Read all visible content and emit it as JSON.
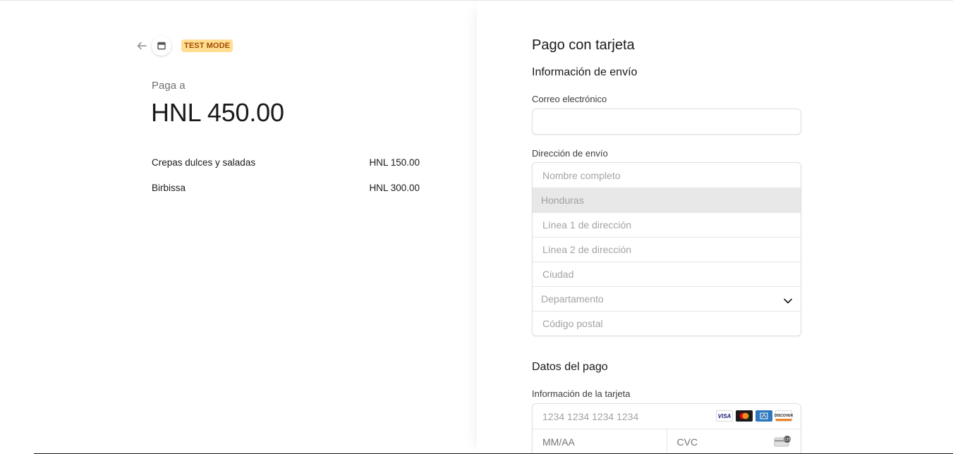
{
  "header": {
    "badge": "TEST MODE"
  },
  "summary": {
    "pay_to_label": "Paga a",
    "total": "HNL 450.00",
    "items": [
      {
        "name": "Crepas dulces y saladas",
        "price": "HNL 150.00"
      },
      {
        "name": "Birbissa",
        "price": "HNL 300.00"
      }
    ]
  },
  "form": {
    "title": "Pago con tarjeta",
    "shipping_section": "Información de envío",
    "email_label": "Correo electrónico",
    "email_value": "",
    "address_label": "Dirección de envío",
    "address": {
      "name_placeholder": "Nombre completo",
      "country": "Honduras",
      "line1_placeholder": "Línea 1 de dirección",
      "line2_placeholder": "Línea 2 de dirección",
      "city_placeholder": "Ciudad",
      "state_placeholder": "Departamento",
      "postal_placeholder": "Código postal"
    },
    "payment_section": "Datos del pago",
    "card_label": "Información de la tarjeta",
    "card": {
      "number_placeholder": "1234 1234 1234 1234",
      "expiry_placeholder": "MM/AA",
      "cvc_placeholder": "CVC",
      "brands": [
        "VISA",
        "mastercard",
        "amex",
        "DISCOVER"
      ]
    }
  },
  "colors": {
    "badge_bg": "#ffde92",
    "badge_text": "#a04b00",
    "disabled_row": "#e8e8e8"
  }
}
